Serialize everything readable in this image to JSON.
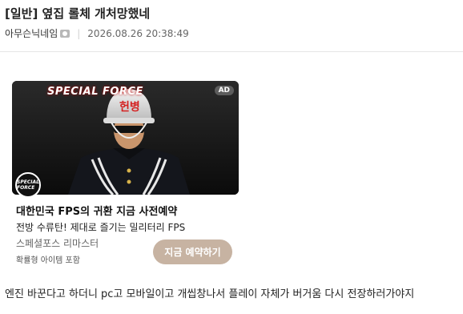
{
  "post": {
    "title": "[일반] 옆집 롤체 개처망했네",
    "author": "아무슨닉네임",
    "date": "2026.08.26 20:38:49",
    "body": "엔진 바꾼다고 하더니 pc고 모바일이고 개씹창나서 플레이 자체가 버거움 다시 전장하러가야지"
  },
  "ad": {
    "badge": "AD",
    "game_logo": "SPECIAL FORCE",
    "helmet_text": "헌병",
    "brand_logo_text": "SPECIAL FORCE",
    "headline": "대한민국 FPS의 귀환 지금 사전예약",
    "description": "전방 수류탄! 제대로 즐기는 밀리터리 FPS",
    "brand": "스페셜포스 리마스터",
    "note": "확률형 아이템 포함",
    "cta": "지금 예약하기"
  },
  "icons": {
    "user": "user-badge-icon"
  },
  "colors": {
    "cta_bg": "#c7b3a2",
    "divider": "#e6e6e6"
  }
}
